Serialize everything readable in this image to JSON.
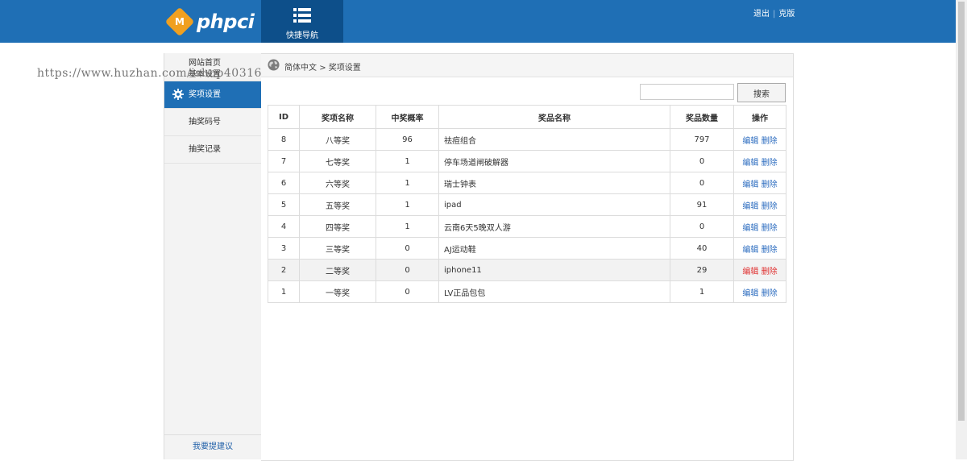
{
  "header": {
    "logo_mark": "M",
    "logo_text": "phpci",
    "quick_nav_label": "快捷导航",
    "links": {
      "logout": "退出",
      "site": "克版"
    }
  },
  "watermark": "https://www.huzhan.com/ishop40316",
  "sidebar": {
    "items": [
      {
        "label": "网站首页"
      },
      {
        "label": "基本设置"
      },
      {
        "label": "奖项设置"
      },
      {
        "label": "抽奖码号"
      },
      {
        "label": "抽奖记录"
      }
    ],
    "bottom_link": "我要提建议"
  },
  "breadcrumb": {
    "root": "简体中文",
    "separator": ">",
    "current": "奖项设置"
  },
  "search": {
    "value": "",
    "button_label": "搜索"
  },
  "table": {
    "headers": [
      "ID",
      "奖项名称",
      "中奖概率",
      "奖品名称",
      "奖品数量",
      "操作"
    ],
    "actions": {
      "edit": "编辑",
      "delete": "删除"
    },
    "rows": [
      {
        "id": "8",
        "award": "八等奖",
        "prob": "96",
        "prize": "祛痘组合",
        "qty": "797"
      },
      {
        "id": "7",
        "award": "七等奖",
        "prob": "1",
        "prize": "停车场道闸破解器",
        "qty": "0"
      },
      {
        "id": "6",
        "award": "六等奖",
        "prob": "1",
        "prize": "瑞士钟表",
        "qty": "0"
      },
      {
        "id": "5",
        "award": "五等奖",
        "prob": "1",
        "prize": "ipad",
        "qty": "91"
      },
      {
        "id": "4",
        "award": "四等奖",
        "prob": "1",
        "prize": "云南6天5晚双人游",
        "qty": "0"
      },
      {
        "id": "3",
        "award": "三等奖",
        "prob": "0",
        "prize": "AJ运动鞋",
        "qty": "40"
      },
      {
        "id": "2",
        "award": "二等奖",
        "prob": "0",
        "prize": "iphone11",
        "qty": "29"
      },
      {
        "id": "1",
        "award": "一等奖",
        "prob": "0",
        "prize": "LV正品包包",
        "qty": "1"
      }
    ]
  }
}
